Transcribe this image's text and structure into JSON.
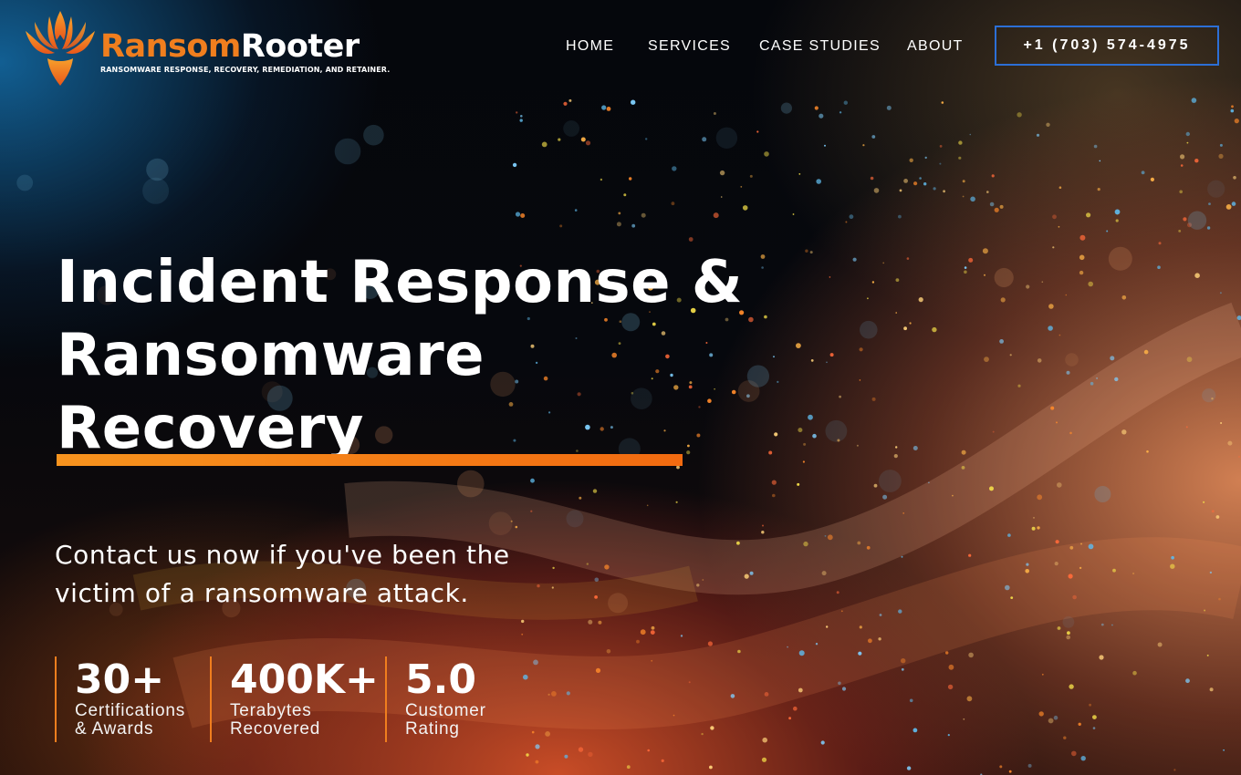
{
  "brand": {
    "name_part1": "Ransom",
    "name_part2": "Rooter",
    "tagline": "RANSOMWARE RESPONSE, RECOVERY, REMEDIATION, AND RETAINER.",
    "logo_icon": "phoenix-logo-icon",
    "primary_color": "#f07e1e"
  },
  "nav": {
    "items": [
      {
        "label": "HOME"
      },
      {
        "label": "SERVICES"
      },
      {
        "label": "CASE STUDIES"
      },
      {
        "label": "ABOUT"
      }
    ],
    "phone": "+1 (703) 574-4975",
    "phone_border_color": "#2c6fd6"
  },
  "hero": {
    "title_lines": [
      "Incident Response &",
      "Ransomware",
      "Recovery"
    ],
    "underline_color": "#f26a10",
    "subtitle_lines": [
      "Contact us now if you've been the",
      "victim of a ransomware attack."
    ]
  },
  "stats": [
    {
      "value": "30+",
      "label_lines": [
        "Certifications",
        "& Awards"
      ]
    },
    {
      "value": "400K+",
      "label_lines": [
        "Terabytes",
        "Recovered"
      ]
    },
    {
      "value": "5.0",
      "label_lines": [
        "Customer",
        "Rating"
      ]
    }
  ]
}
